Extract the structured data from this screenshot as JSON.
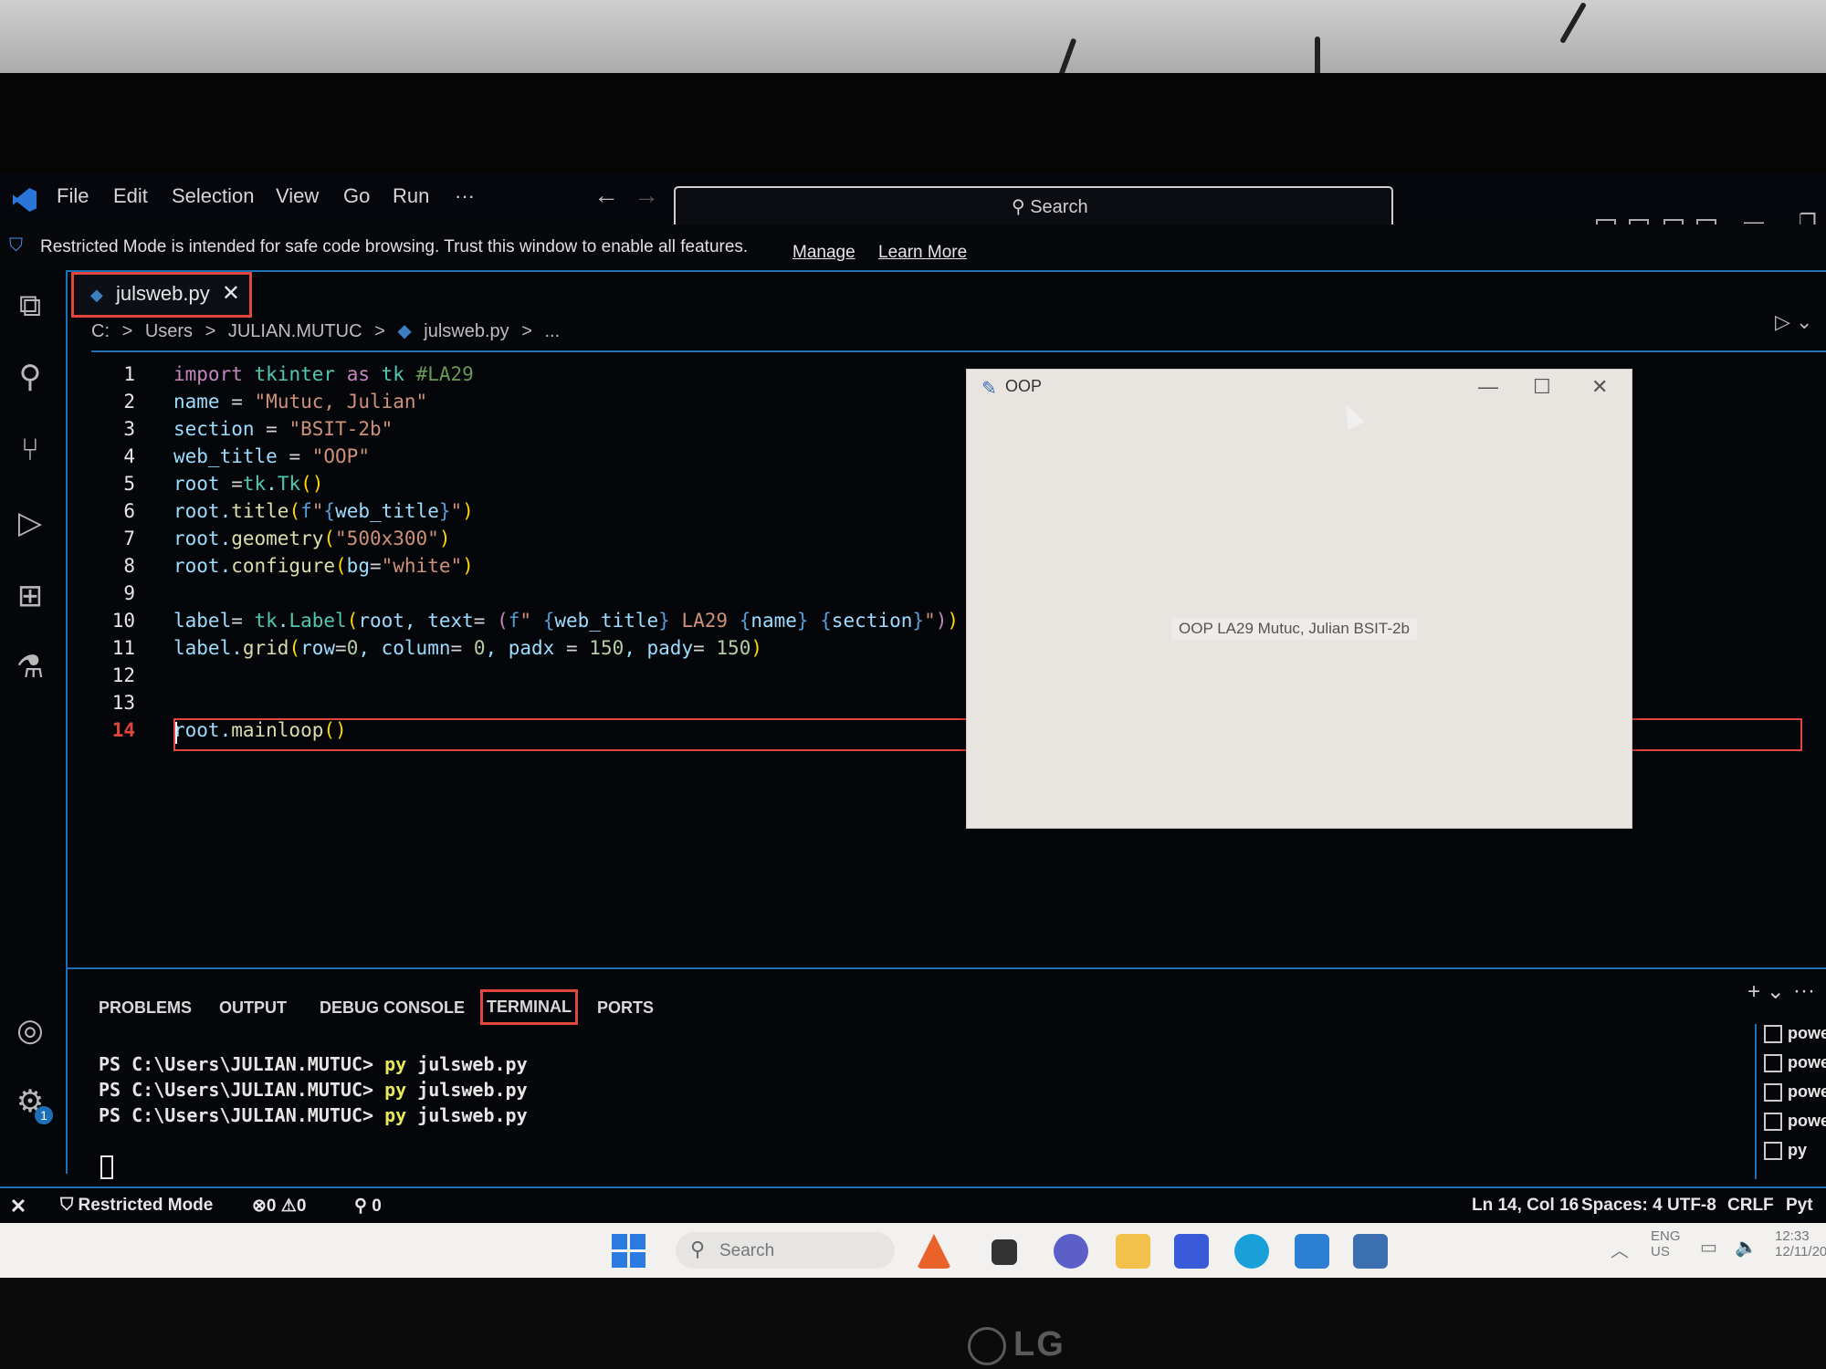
{
  "menu": [
    "File",
    "Edit",
    "Selection",
    "View",
    "Go",
    "Run",
    "···"
  ],
  "search": {
    "placeholder": "Search"
  },
  "restricted_bar": {
    "message": "Restricted Mode is intended for safe code browsing. Trust this window to enable all features.",
    "manage": "Manage",
    "learn_more": "Learn More"
  },
  "tab": {
    "filename": "julsweb.py",
    "close": "✕"
  },
  "breadcrumb": [
    "C:",
    ">",
    "Users",
    ">",
    "JULIAN.MUTUC",
    ">",
    "julsweb.py",
    ">",
    "..."
  ],
  "editor": {
    "line_numbers": [
      "1",
      "2",
      "3",
      "4",
      "5",
      "6",
      "7",
      "8",
      "9",
      "10",
      "11",
      "12",
      "13",
      "14"
    ],
    "active_line": "14"
  },
  "tk_window": {
    "title": "OOP",
    "label": "OOP LA29 Mutuc, Julian BSIT-2b"
  },
  "panel": {
    "tabs": [
      "PROBLEMS",
      "OUTPUT",
      "DEBUG CONSOLE",
      "TERMINAL",
      "PORTS"
    ],
    "active_tab": "TERMINAL",
    "terminal_prompt": "PS C:\\Users\\JULIAN.MUTUC>",
    "terminal_cmd": "py",
    "terminal_arg": "julsweb.py",
    "terminal_list": [
      "powe",
      "powe",
      "powe",
      "powe",
      "py"
    ]
  },
  "statusbar": {
    "restricted": "Restricted Mode",
    "errors": "0",
    "warnings": "0",
    "ports": "0",
    "position": "Ln 14, Col 16",
    "spaces": "Spaces: 4",
    "encoding": "UTF-8",
    "eol": "CRLF",
    "language": "Pyt"
  },
  "taskbar": {
    "search": "Search",
    "lang": "ENG",
    "region": "US",
    "time": "12:33",
    "date": "12/11/20"
  },
  "monitor_brand": "LG",
  "colors": {
    "accent": "#1f6fb8",
    "highlight": "#e0463a"
  }
}
